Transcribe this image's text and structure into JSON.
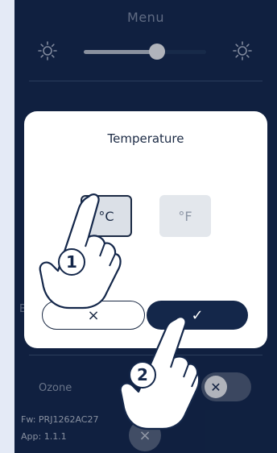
{
  "menu": {
    "title": "Menu"
  },
  "brightness": {
    "level_percent": 60,
    "low_icon": "sun-icon",
    "high_icon": "sun-icon"
  },
  "dialog": {
    "title": "Temperature",
    "celsius_label": "°C",
    "fahrenheit_label": "°F",
    "selected_unit": "celsius",
    "cancel_symbol": "×",
    "confirm_symbol": "✓"
  },
  "background_label": "B",
  "ozone": {
    "label": "Ozone",
    "toggle_symbol": "✕",
    "enabled": false
  },
  "footer": {
    "firmware": "Fw: PRJ1262AC27",
    "app_version": "App: 1.1.1",
    "close_symbol": "×"
  },
  "steps": {
    "step_one": "1",
    "step_two": "2"
  },
  "colors": {
    "page_bg": "#e4eaf6",
    "screen_bg": "#14274a",
    "dialog_bg": "#ffffff",
    "accent": "#14274a"
  }
}
